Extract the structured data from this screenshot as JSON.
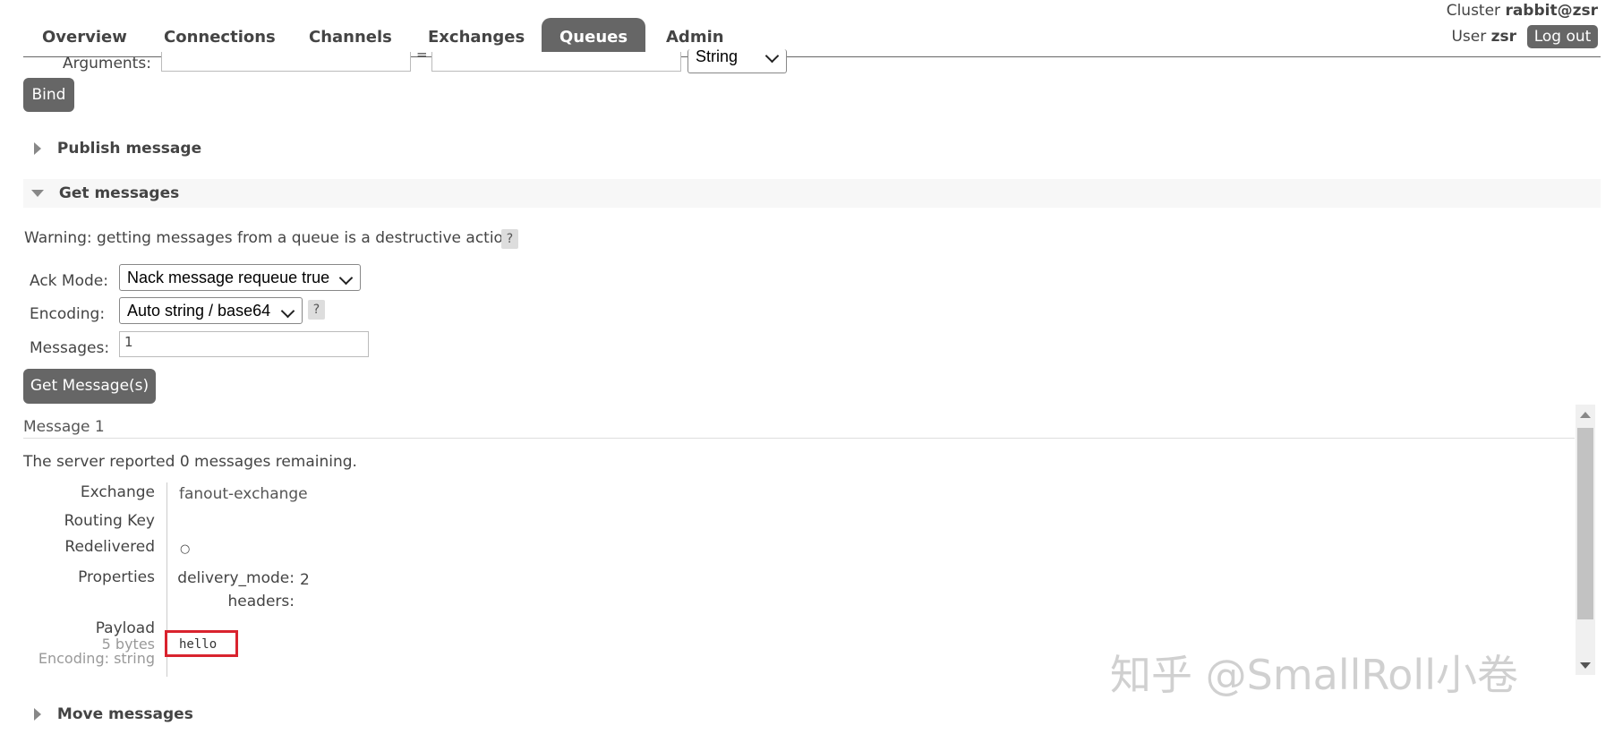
{
  "nav": {
    "tabs": [
      {
        "label": "Overview"
      },
      {
        "label": "Connections"
      },
      {
        "label": "Channels"
      },
      {
        "label": "Exchanges"
      },
      {
        "label": "Queues",
        "active": true
      },
      {
        "label": "Admin"
      }
    ]
  },
  "header": {
    "cluster_label": "Cluster",
    "cluster_name": "rabbit@zsr",
    "user_label": "User",
    "user_name": "zsr",
    "logout_label": "Log out"
  },
  "bind": {
    "arguments_label": "Arguments:",
    "equals": "=",
    "type_value": "String",
    "bind_button": "Bind"
  },
  "sections": {
    "publish": "Publish message",
    "get": "Get messages",
    "move": "Move messages"
  },
  "get_messages": {
    "warning": "Warning: getting messages from a queue is a destructive action.",
    "help": "?",
    "ack_label": "Ack Mode:",
    "ack_value": "Nack message requeue true",
    "encoding_label": "Encoding:",
    "encoding_value": "Auto string / base64",
    "messages_label": "Messages:",
    "messages_value": "1",
    "button": "Get Message(s)"
  },
  "result": {
    "title": "Message 1",
    "remaining_prefix": "The server reported ",
    "remaining_count": "0",
    "remaining_suffix": " messages remaining.",
    "rows": {
      "exchange_label": "Exchange",
      "exchange_value": "fanout-exchange",
      "routing_label": "Routing Key",
      "routing_value": "",
      "redelivered_label": "Redelivered",
      "redelivered_value": "○",
      "properties_label": "Properties",
      "delivery_mode_label": "delivery_mode:",
      "delivery_mode_value": "2",
      "headers_label": "headers:",
      "payload_label": "Payload",
      "payload_size": "5 bytes",
      "payload_encoding": "Encoding: string",
      "payload_value": "hello"
    }
  },
  "watermark": "知乎 @SmallRoll小卷",
  "colors": {
    "active_tab": "#666666",
    "button": "#666666",
    "highlight_border": "#d9232e",
    "section_band": "#f7f7f7"
  }
}
